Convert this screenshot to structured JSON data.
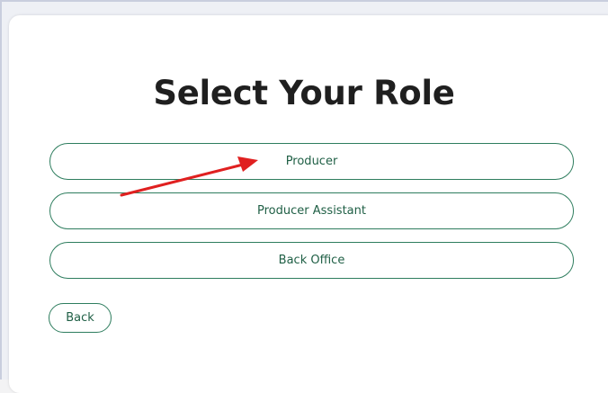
{
  "page": {
    "title": "Select Your Role"
  },
  "roles": [
    {
      "label": "Producer"
    },
    {
      "label": "Producer Assistant"
    },
    {
      "label": "Back Office"
    }
  ],
  "back_button": {
    "label": "Back"
  },
  "colors": {
    "accent": "#2e7d5e",
    "button_text": "#1f5f45",
    "annotation_arrow": "#e02020"
  }
}
